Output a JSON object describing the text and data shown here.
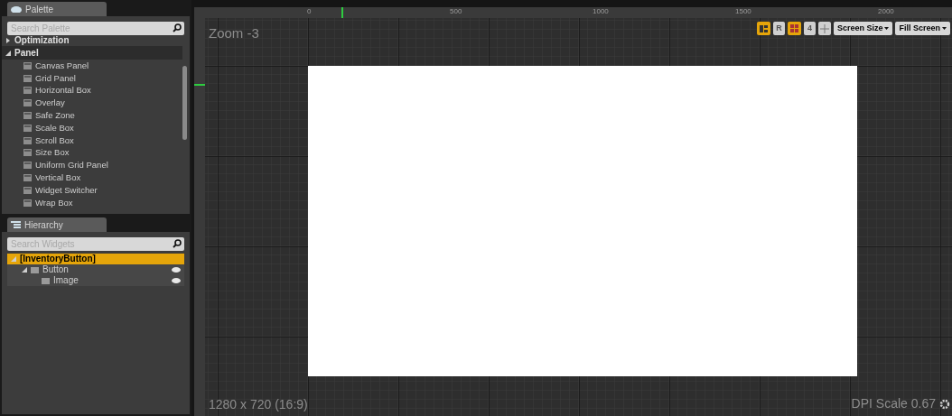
{
  "palette": {
    "title": "Palette",
    "search": {
      "placeholder": "Search Palette"
    },
    "clipped_category": {
      "label": "Optimization",
      "expanded": false
    },
    "category": {
      "label": "Panel",
      "expanded": true
    },
    "items": [
      "Canvas Panel",
      "Grid Panel",
      "Horizontal Box",
      "Overlay",
      "Safe Zone",
      "Scale Box",
      "Scroll Box",
      "Size Box",
      "Uniform Grid Panel",
      "Vertical Box",
      "Widget Switcher",
      "Wrap Box"
    ]
  },
  "hierarchy": {
    "title": "Hierarchy",
    "search": {
      "placeholder": "Search Widgets"
    },
    "tree": [
      {
        "label": "[InventoryButton]",
        "selected": true,
        "expanded": true,
        "children": [
          {
            "label": "Button",
            "selected": false,
            "expanded": true,
            "visible": true,
            "children": [
              {
                "label": "Image",
                "selected": false,
                "visible": true
              }
            ]
          }
        ]
      }
    ]
  },
  "canvas": {
    "ruler_labels": [
      "0",
      "500",
      "1000",
      "1500",
      "2000"
    ],
    "zoom": "Zoom -3",
    "toolbar": [
      {
        "kind": "icon",
        "on": true
      },
      {
        "kind": "text",
        "label": "R",
        "on": false
      },
      {
        "kind": "grid",
        "on": true
      },
      {
        "kind": "text",
        "label": "4",
        "on": false
      },
      {
        "kind": "move",
        "on": false
      },
      {
        "kind": "dropdown",
        "label": "Screen Size"
      },
      {
        "kind": "dropdown",
        "label": "Fill Screen"
      }
    ],
    "resolution": "1280 x 720 (16:9)",
    "dpi": "DPI Scale 0.67"
  }
}
